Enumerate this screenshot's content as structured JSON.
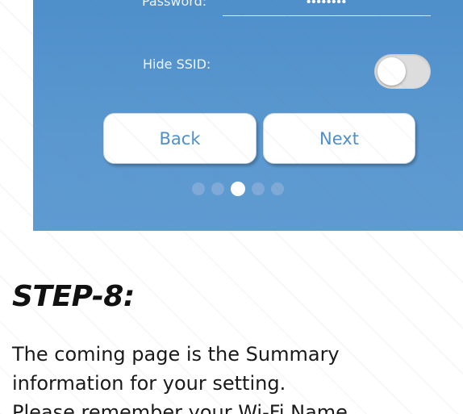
{
  "form": {
    "password_label": "Password:",
    "password_value": "••••••••",
    "hide_ssid_label": "Hide SSID:",
    "hide_ssid_enabled": false
  },
  "buttons": {
    "back_label": "Back",
    "next_label": "Next"
  },
  "pagination": {
    "total": 5,
    "active_index": 2
  },
  "colors": {
    "panel": "#5a98cf",
    "button_text": "#4f8fca",
    "dot_inactive": "#7fa9d6",
    "dot_active": "#ffffff"
  },
  "instructions": {
    "step_title": "STEP-8:",
    "lines": [
      "The coming page is the Summary",
      "information for your setting.",
      "Please remember your Wi-Fi Name"
    ]
  }
}
